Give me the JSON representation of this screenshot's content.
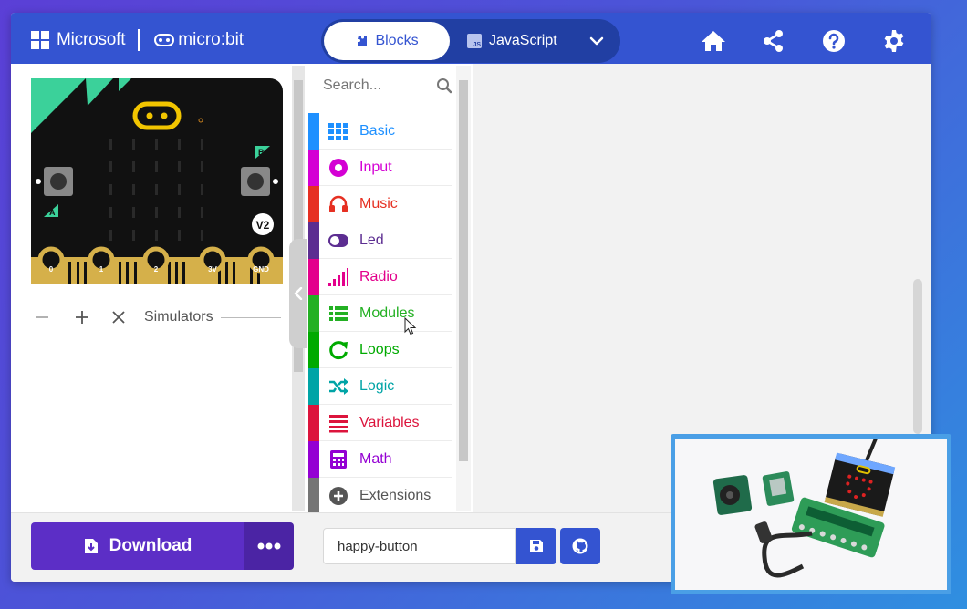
{
  "header": {
    "brand": "Microsoft",
    "product": "micro:bit",
    "editor_tabs": {
      "blocks": "Blocks",
      "javascript": "JavaScript",
      "js_badge": "JS"
    },
    "icons": [
      "home-icon",
      "share-icon",
      "help-icon",
      "settings-icon"
    ]
  },
  "simulator": {
    "label": "Simulators",
    "board": {
      "button_a": "A",
      "button_b": "B",
      "version": "V2",
      "pins": [
        "0",
        "1",
        "2",
        "3V",
        "GND"
      ]
    }
  },
  "toolbox": {
    "search_placeholder": "Search...",
    "categories": [
      {
        "label": "Basic",
        "color": "#1E90FF",
        "icon": "grid-icon"
      },
      {
        "label": "Input",
        "color": "#D400D4",
        "icon": "input-circle-icon"
      },
      {
        "label": "Music",
        "color": "#E63022",
        "icon": "headphones-icon"
      },
      {
        "label": "Led",
        "color": "#5C2D91",
        "icon": "toggle-icon"
      },
      {
        "label": "Radio",
        "color": "#E3008C",
        "icon": "signal-bars-icon"
      },
      {
        "label": "Modules",
        "color": "#23B023",
        "icon": "modules-icon"
      },
      {
        "label": "Loops",
        "color": "#00AA00",
        "icon": "loop-arrow-icon"
      },
      {
        "label": "Logic",
        "color": "#00A4A6",
        "icon": "shuffle-icon"
      },
      {
        "label": "Variables",
        "color": "#DC143C",
        "icon": "list-lines-icon"
      },
      {
        "label": "Math",
        "color": "#9400D3",
        "icon": "calculator-icon"
      },
      {
        "label": "Extensions",
        "color": "#757575",
        "icon": "plus-circle-icon"
      }
    ]
  },
  "footer": {
    "download_label": "Download",
    "project_name": "happy-button"
  },
  "colors": {
    "header_bg": "#3454D1",
    "download_bg": "#5C2EC6",
    "pip_border": "#4A9FE6"
  }
}
